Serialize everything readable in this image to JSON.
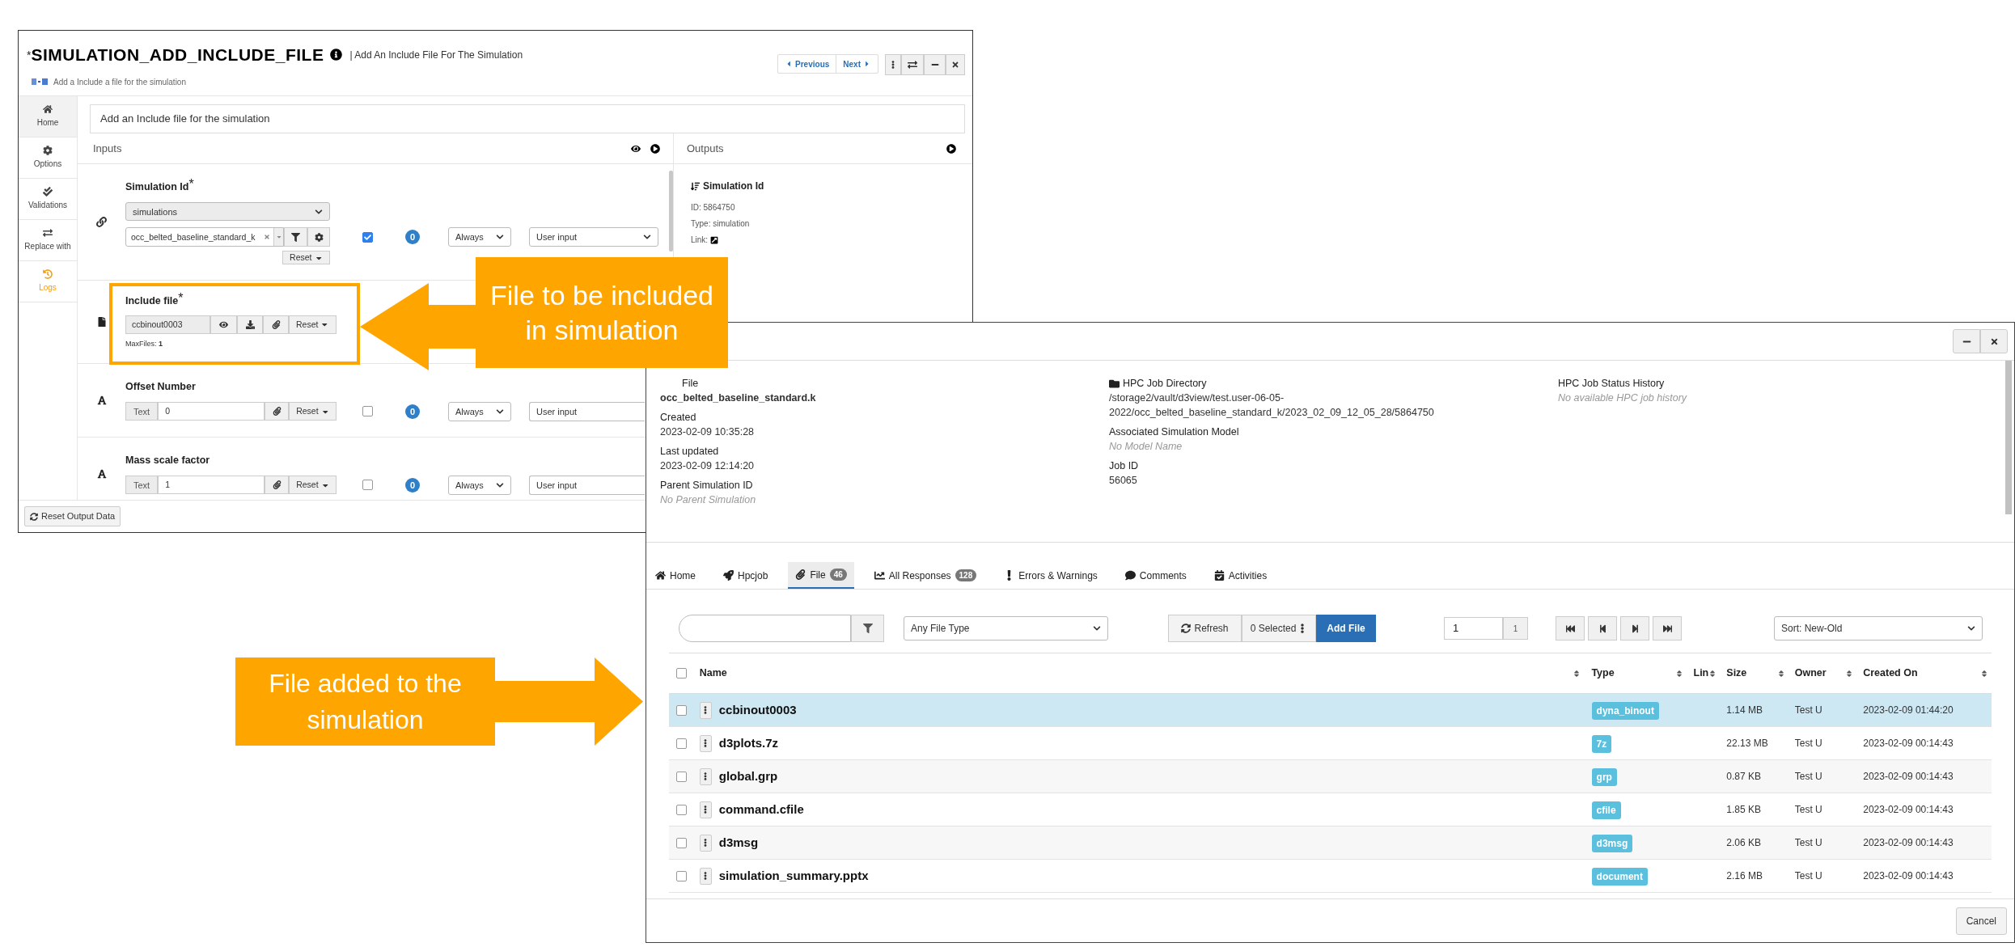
{
  "include_dialog": {
    "modified_mark": "*",
    "title": "SIMULATION_ADD_INCLUDE_FILE",
    "subtitle": "| Add An Include File For The Simulation",
    "hint": "Add a Include a file for the simulation",
    "nav_buttons": [
      "Previous",
      "Next"
    ],
    "sidebar": [
      {
        "label": "Home",
        "selected": false
      },
      {
        "label": "Options",
        "selected": false
      },
      {
        "label": "Validations",
        "selected": false
      },
      {
        "label": "Replace with",
        "selected": false
      },
      {
        "label": "Logs",
        "selected": true
      }
    ],
    "description": "Add an Include file for the simulation",
    "inputs_title": "Inputs",
    "inputs": [
      {
        "kind": "select_search",
        "label": "Simulation Id",
        "required_mark": "*",
        "select": "simulations",
        "value": "occ_belted_baseline_standard_k",
        "reset": "Reset",
        "checked": true,
        "count": "0",
        "when": "Always",
        "source": "User input"
      },
      {
        "kind": "file",
        "label": "Include file",
        "required_mark": "*",
        "value": "ccbinout0003",
        "reset": "Reset",
        "max_files": "MaxFiles: **1**"
      },
      {
        "kind": "text",
        "label": "Offset Number",
        "addon": "Text",
        "value": "0",
        "reset": "Reset",
        "checked": false,
        "count": "0",
        "when": "Always",
        "source": "User input"
      },
      {
        "kind": "text",
        "label": "Mass scale factor",
        "addon": "Text",
        "value": "1",
        "reset": "Reset",
        "checked": false,
        "count": "0",
        "when": "Always",
        "source": "User input"
      }
    ],
    "reset_output": "Reset Output Data",
    "outputs_title": "Outputs",
    "output": {
      "title": "Simulation Id",
      "lines": [
        "ID: 5864750",
        "Type: simulation"
      ],
      "link_label": "Link:"
    }
  },
  "file_window": {
    "details": [
      [
        {
          "label": "File",
          "value": "occ_belted_baseline_standard.k",
          "emphasis": true
        },
        {
          "label": "Created",
          "value": "2023-02-09 10:35:28"
        },
        {
          "label": "Last updated",
          "value": "2023-02-09 12:14:20"
        },
        {
          "label": "Parent Simulation ID",
          "value": "No Parent Simulation",
          "empty": true
        }
      ],
      [
        {
          "label": "HPC Job Directory",
          "folder": true,
          "value": "/storage2/vault/d3view/test.user-06-05-2022/occ_belted_baseline_standard_k/2023_02_09_12_05_28/5864750"
        },
        {
          "label": "Associated Simulation Model",
          "value": "No Model Name",
          "empty": true
        },
        {
          "label": "Job ID",
          "value": "56065"
        }
      ],
      [
        {
          "label": "HPC Job Status History",
          "value": "No available HPC job history",
          "empty": true
        }
      ]
    ],
    "tabs": [
      {
        "label": "Home",
        "selected": false
      },
      {
        "label": "Hpcjob",
        "selected": false
      },
      {
        "label": "File",
        "count": "46",
        "selected": true
      },
      {
        "label": "All Responses",
        "count": "128",
        "selected": false
      },
      {
        "label": "Errors & Warnings",
        "selected": false
      },
      {
        "label": "Comments",
        "selected": false
      },
      {
        "label": "Activities",
        "selected": false
      }
    ],
    "file_type": "Any File Type",
    "refresh": "Refresh",
    "selected_count": "0 Selected",
    "add_file": "Add File",
    "page": "1",
    "page_count": "1",
    "sort": "Sort: New-Old",
    "header_checked": false,
    "columns": [
      "Name",
      "Type",
      "Lin",
      "Size",
      "Owner",
      "Created On"
    ],
    "rows": [
      {
        "name": "ccbinout0003",
        "type": "dyna_binout",
        "size": "1.14 MB",
        "owner": "Test U",
        "created": "2023-02-09 01:44:20",
        "checked": false,
        "selected": true
      },
      {
        "name": "d3plots.7z",
        "type": "7z",
        "size": "22.13 MB",
        "owner": "Test U",
        "created": "2023-02-09 00:14:43",
        "checked": false,
        "selected": false
      },
      {
        "name": "global.grp",
        "type": "grp",
        "size": "0.87 KB",
        "owner": "Test U",
        "created": "2023-02-09 00:14:43",
        "checked": false,
        "selected": false
      },
      {
        "name": "command.cfile",
        "type": "cfile",
        "size": "1.85 KB",
        "owner": "Test U",
        "created": "2023-02-09 00:14:43",
        "checked": false,
        "selected": false
      },
      {
        "name": "d3msg",
        "type": "d3msg",
        "size": "2.06 KB",
        "owner": "Test U",
        "created": "2023-02-09 00:14:43",
        "checked": false,
        "selected": false
      },
      {
        "name": "simulation_summary.pptx",
        "type": "document",
        "size": "2.16 MB",
        "owner": "Test U",
        "created": "2023-02-09 00:14:43",
        "checked": false,
        "selected": false
      }
    ],
    "cancel": "Cancel"
  },
  "callouts": [
    {
      "text": "File to be included in simulation",
      "kind": "left"
    },
    {
      "text": "File added to the simulation",
      "kind": "right"
    }
  ]
}
